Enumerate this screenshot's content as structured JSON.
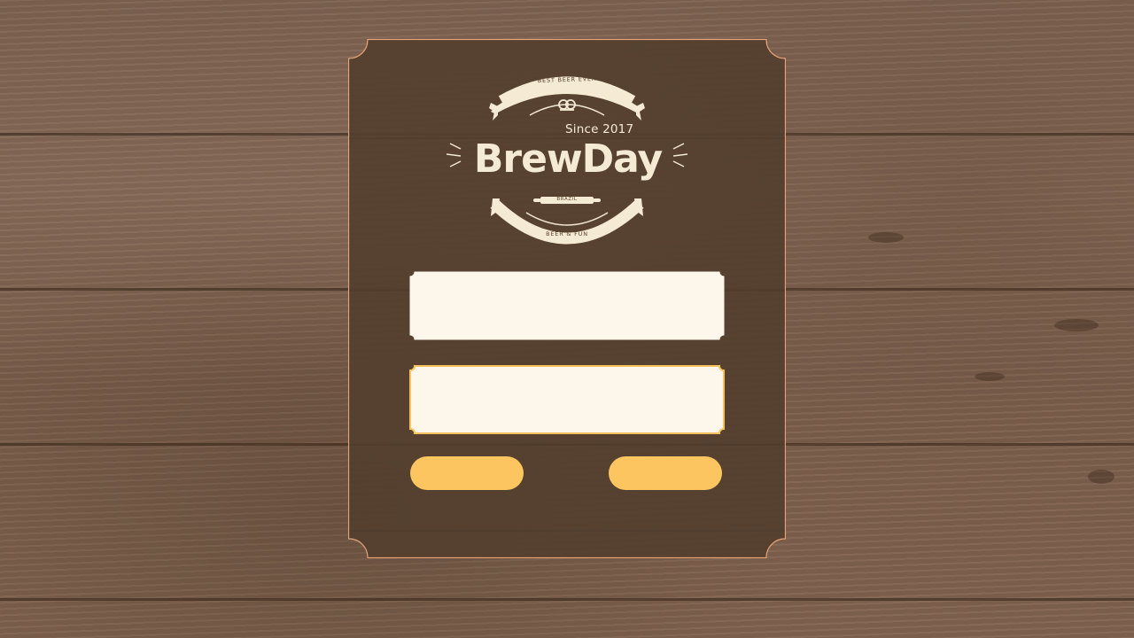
{
  "branding": {
    "name": "BrewDay",
    "since": "Since 2017",
    "ribbon_top": "BEST BEER EVER",
    "ribbon_bottom": "BEER & FUN",
    "origin": "BRAZIL"
  },
  "form": {
    "username": {
      "value": "",
      "placeholder": ""
    },
    "password": {
      "value": "",
      "placeholder": ""
    },
    "left_button_label": "",
    "right_button_label": ""
  },
  "colors": {
    "card_background": "#54402f",
    "card_border": "#e8a477",
    "field_fill": "#fdf6ea",
    "field_focus_border": "#f5c15c",
    "button_fill": "#fcc55f",
    "logo_cream": "#f5ead3",
    "wood_background": "#7d6150"
  },
  "icons": {
    "pretzel": "pretzel-icon",
    "rolling_pin": "rolling-pin-icon"
  }
}
